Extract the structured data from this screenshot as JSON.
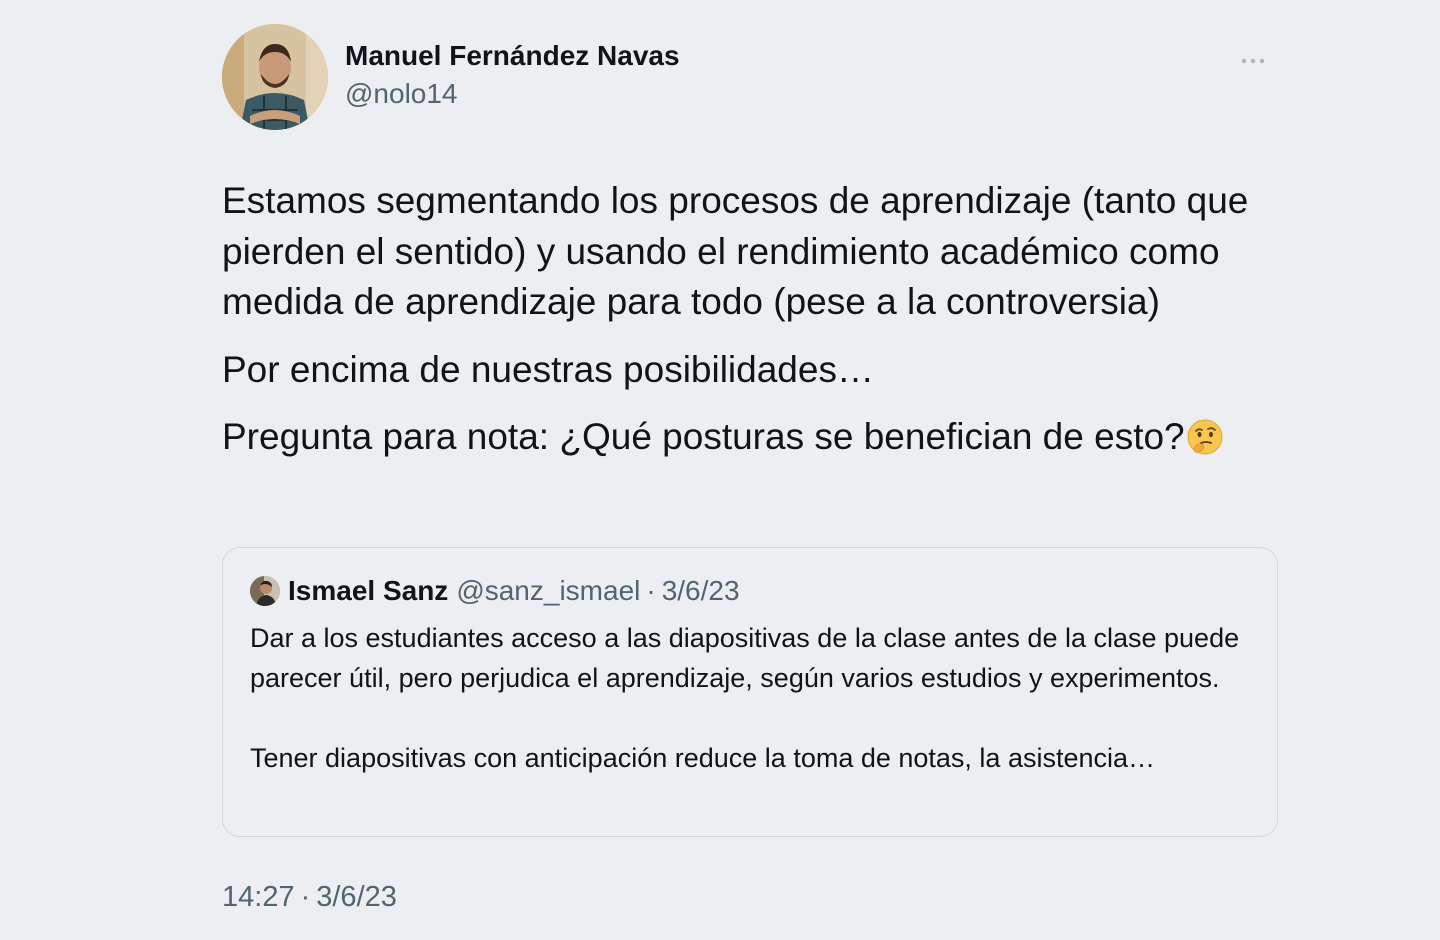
{
  "tweet": {
    "author": {
      "name": "Manuel Fernández Navas",
      "handle": "@nolo14"
    },
    "more_icon": "more-dots-icon",
    "paragraphs": [
      "Estamos segmentando los procesos de aprendizaje (tanto que pierden el sentido) y usando el rendimiento académico como medida de aprendizaje para todo (pese a la controversia)",
      "Por encima de nuestras posibilidades…",
      "Pregunta para nota: ¿Qué posturas se benefician de esto?"
    ],
    "emoji": "thinking-face-emoji",
    "time": "14:27",
    "separator": "·",
    "date": "3/6/23"
  },
  "quoted_tweet": {
    "author": {
      "name": "Ismael Sanz",
      "handle": "@sanz_ismael"
    },
    "separator": "·",
    "date": "3/6/23",
    "paragraphs": [
      "Dar a los estudiantes acceso a las diapositivas de la clase antes de la clase puede parecer útil, pero perjudica el aprendizaje, según varios estudios y experimentos.",
      "Tener diapositivas con anticipación reduce la toma de notas, la asistencia…"
    ]
  },
  "colors": {
    "background": "#eceef1",
    "text_primary": "#0f1419",
    "text_secondary": "#536471",
    "border": "#d4d8dc"
  }
}
